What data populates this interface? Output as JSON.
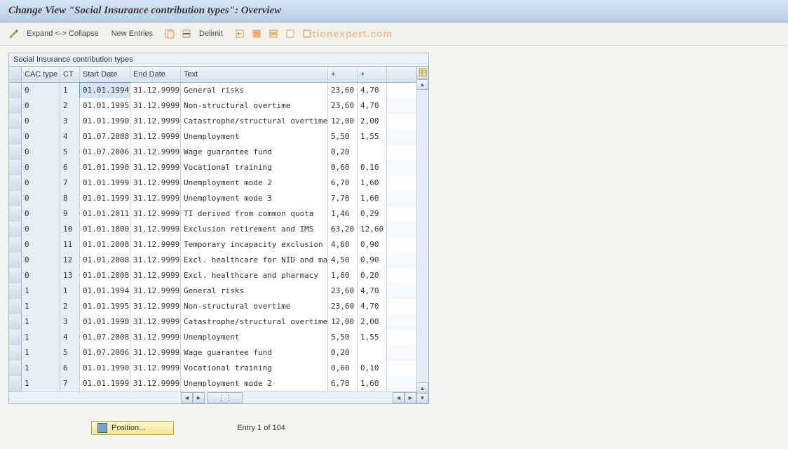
{
  "title": "Change View \"Social Insurance contribution types\": Overview",
  "toolbar": {
    "expand_collapse": "Expand <-> Collapse",
    "new_entries": "New Entries",
    "delimit": "Delimit"
  },
  "watermark": "tionexpert.com",
  "panel": {
    "title": "Social Insurance contribution types",
    "columns": {
      "cac": "CAC type",
      "ct": "CT",
      "start": "Start Date",
      "end": "End Date",
      "text": "Text",
      "p1": "+",
      "p2": "+"
    },
    "rows": [
      {
        "cac": "0",
        "ct": "1",
        "sd": "01.01.1994",
        "ed": "31.12.9999",
        "txt": "General risks",
        "p1": "23,60",
        "p2": "4,70"
      },
      {
        "cac": "0",
        "ct": "2",
        "sd": "01.01.1995",
        "ed": "31.12.9999",
        "txt": "Non-structural overtime",
        "p1": "23,60",
        "p2": "4,70"
      },
      {
        "cac": "0",
        "ct": "3",
        "sd": "01.01.1990",
        "ed": "31.12.9999",
        "txt": "Catastrophe/structural overtime",
        "p1": "12,00",
        "p2": "2,00"
      },
      {
        "cac": "0",
        "ct": "4",
        "sd": "01.07.2008",
        "ed": "31.12.9999",
        "txt": "Unemployment",
        "p1": "5,50",
        "p2": "1,55"
      },
      {
        "cac": "0",
        "ct": "5",
        "sd": "01.07.2006",
        "ed": "31.12.9999",
        "txt": "Wage guarantee fund",
        "p1": "0,20",
        "p2": ""
      },
      {
        "cac": "0",
        "ct": "6",
        "sd": "01.01.1990",
        "ed": "31.12.9999",
        "txt": "Vocational training",
        "p1": "0,60",
        "p2": "0,10"
      },
      {
        "cac": "0",
        "ct": "7",
        "sd": "01.01.1999",
        "ed": "31.12.9999",
        "txt": "Unemployment mode 2",
        "p1": "6,70",
        "p2": "1,60"
      },
      {
        "cac": "0",
        "ct": "8",
        "sd": "01.01.1999",
        "ed": "31.12.9999",
        "txt": "Unemployment mode 3",
        "p1": "7,70",
        "p2": "1,60"
      },
      {
        "cac": "0",
        "ct": "9",
        "sd": "01.01.2011",
        "ed": "31.12.9999",
        "txt": "TI derived from common quota",
        "p1": "1,46",
        "p2": "0,29"
      },
      {
        "cac": "0",
        "ct": "10",
        "sd": "01.01.1800",
        "ed": "31.12.9999",
        "txt": "Exclusion retirement and IMS",
        "p1": "63,20",
        "p2": "12,60"
      },
      {
        "cac": "0",
        "ct": "11",
        "sd": "01.01.2008",
        "ed": "31.12.9999",
        "txt": "Temporary incapacity exclusion",
        "p1": "4,60",
        "p2": "0,90"
      },
      {
        "cac": "0",
        "ct": "12",
        "sd": "01.01.2008",
        "ed": "31.12.9999",
        "txt": "Excl. healthcare for NID and mat",
        "p1": "4,50",
        "p2": "0,90"
      },
      {
        "cac": "0",
        "ct": "13",
        "sd": "01.01.2008",
        "ed": "31.12.9999",
        "txt": "Excl. healthcare and pharmacy",
        "p1": "1,00",
        "p2": "0,20"
      },
      {
        "cac": "1",
        "ct": "1",
        "sd": "01.01.1994",
        "ed": "31.12.9999",
        "txt": "General risks",
        "p1": "23,60",
        "p2": "4,70"
      },
      {
        "cac": "1",
        "ct": "2",
        "sd": "01.01.1995",
        "ed": "31.12.9999",
        "txt": "Non-structural overtime",
        "p1": "23,60",
        "p2": "4,70"
      },
      {
        "cac": "1",
        "ct": "3",
        "sd": "01.01.1990",
        "ed": "31.12.9999",
        "txt": "Catastrophe/structural overtime",
        "p1": "12,00",
        "p2": "2,00"
      },
      {
        "cac": "1",
        "ct": "4",
        "sd": "01.07.2008",
        "ed": "31.12.9999",
        "txt": "Unemployment",
        "p1": "5,50",
        "p2": "1,55"
      },
      {
        "cac": "1",
        "ct": "5",
        "sd": "01.07.2006",
        "ed": "31.12.9999",
        "txt": "Wage guarantee fund",
        "p1": "0,20",
        "p2": ""
      },
      {
        "cac": "1",
        "ct": "6",
        "sd": "01.01.1990",
        "ed": "31.12.9999",
        "txt": "Vocational training",
        "p1": "0,60",
        "p2": "0,10"
      },
      {
        "cac": "1",
        "ct": "7",
        "sd": "01.01.1999",
        "ed": "31.12.9999",
        "txt": "Unemployment mode 2",
        "p1": "6,70",
        "p2": "1,60"
      }
    ]
  },
  "footer": {
    "position_btn": "Position...",
    "entry_text": "Entry 1 of 104"
  }
}
